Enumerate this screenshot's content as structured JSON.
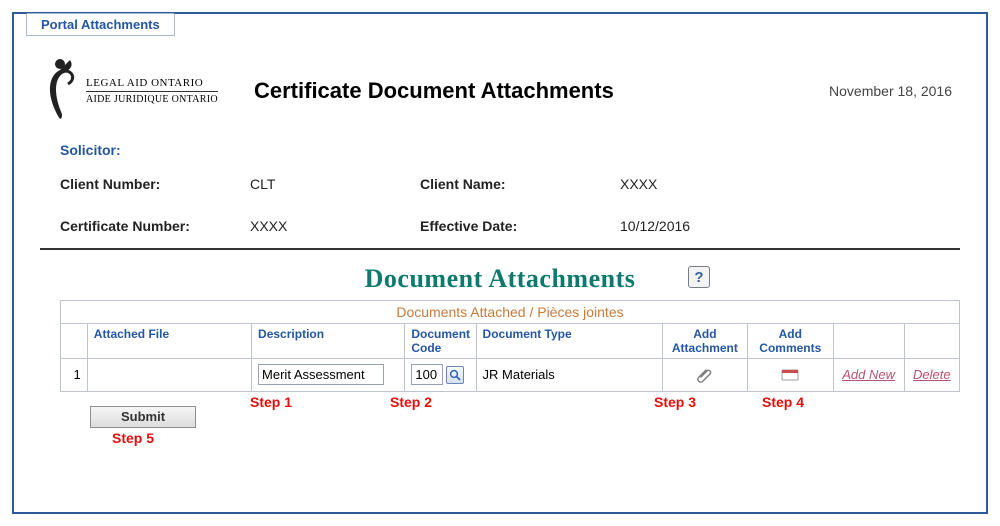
{
  "tab": {
    "label": "Portal Attachments"
  },
  "logo": {
    "main": "LEGAL AID ONTARIO",
    "sub": "AIDE JURIDIQUE ONTARIO"
  },
  "header": {
    "title": "Certificate Document Attachments",
    "date": "November 18, 2016"
  },
  "info": {
    "solicitor_label": "Solicitor:",
    "client_number_label": "Client Number:",
    "client_number_value": "CLT",
    "client_name_label": "Client Name:",
    "client_name_value": "XXXX",
    "certificate_number_label": "Certificate Number:",
    "certificate_number_value": "XXXX",
    "effective_date_label": "Effective Date:",
    "effective_date_value": "10/12/2016"
  },
  "doc_attach": {
    "section_title": "Document Attachments",
    "help_glyph": "?",
    "table_caption": "Documents Attached / Pièces jointes",
    "columns": {
      "attached_file": "Attached File",
      "description": "Description",
      "document_code": "Document Code",
      "document_type": "Document Type",
      "add_attachment": "Add Attachment",
      "add_comments": "Add Comments"
    },
    "rows": [
      {
        "num": "1",
        "attached_file": "",
        "description": "Merit Assessment",
        "document_code": "100",
        "document_type": "JR Materials"
      }
    ],
    "actions": {
      "add_new": "Add New",
      "delete": "Delete"
    }
  },
  "steps": {
    "s1": "Step 1",
    "s2": "Step 2",
    "s3": "Step 3",
    "s4": "Step 4",
    "s5": "Step 5"
  },
  "buttons": {
    "submit": "Submit"
  }
}
